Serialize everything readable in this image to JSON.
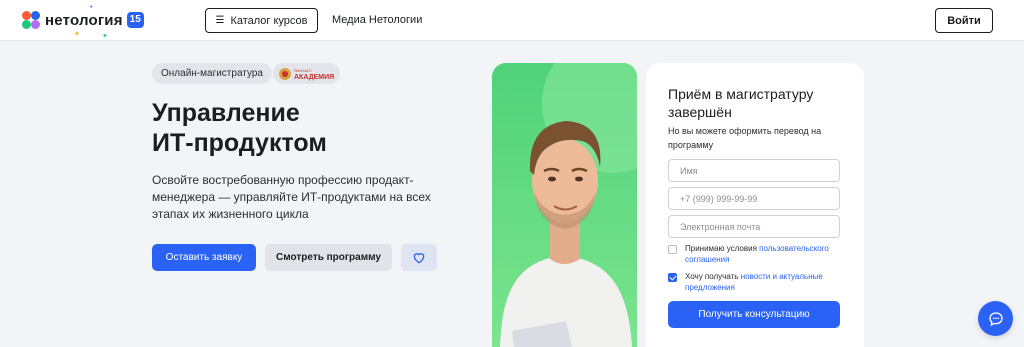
{
  "header": {
    "logo_text": "нетология",
    "logo_badge": "15",
    "catalog_label": "Каталог курсов",
    "media_label": "Медиа Нетологии",
    "login_label": "Войти"
  },
  "hero": {
    "tags": [
      "Онлайн-магистратура"
    ],
    "partner_logo": {
      "small": "РАНХиГС",
      "big": "АКАДЕМИЯ"
    },
    "title_line1": "Управление",
    "title_line2": "ИТ-продуктом",
    "description": "Освойте востребованную профессию продакт-менеджера — управляйте ИТ-продуктами на всех этапах их жизненного цикла",
    "apply_label": "Оставить заявку",
    "program_label": "Смотреть программу"
  },
  "form": {
    "title": "Приём в магистратуру завершён",
    "subtitle": "Но вы можете оформить перевод на программу",
    "name_placeholder": "Имя",
    "phone_placeholder": "+7 (999) 999-99-99",
    "email_placeholder": "Электронная почта",
    "agreement_prefix": "Принимаю условия ",
    "agreement_link": "пользовательского соглашения",
    "agreement_checked": false,
    "news_prefix": "Хочу получать ",
    "news_link": "новости и актуальные предложения",
    "news_checked": true,
    "submit_label": "Получить консультацию"
  },
  "colors": {
    "accent": "#2a62f5",
    "hero_green": "#5fd87a",
    "background": "#f3f4f7"
  },
  "icons": [
    "catalog-icon",
    "heart-icon",
    "chat-icon"
  ]
}
